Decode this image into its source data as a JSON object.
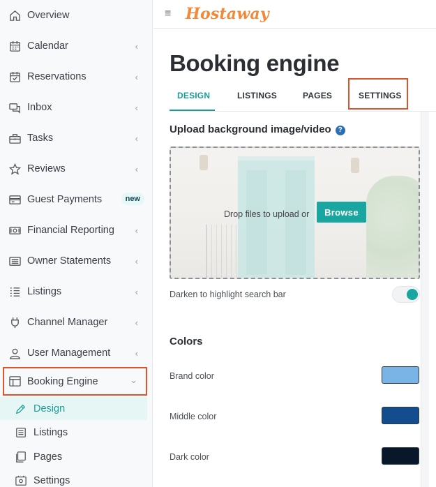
{
  "sidebar": {
    "items": [
      {
        "label": "Overview",
        "icon": "home-icon"
      },
      {
        "label": "Calendar",
        "icon": "calendar-icon",
        "chevron": "‹"
      },
      {
        "label": "Reservations",
        "icon": "calendar-check-icon",
        "chevron": "‹"
      },
      {
        "label": "Inbox",
        "icon": "chat-icon",
        "chevron": "‹"
      },
      {
        "label": "Tasks",
        "icon": "toolbox-icon",
        "chevron": "‹"
      },
      {
        "label": "Reviews",
        "icon": "star-icon",
        "chevron": "‹"
      },
      {
        "label": "Guest Payments",
        "icon": "credit-card-icon",
        "badge": "new"
      },
      {
        "label": "Financial Reporting",
        "icon": "money-icon",
        "chevron": "‹"
      },
      {
        "label": "Owner Statements",
        "icon": "statement-icon",
        "chevron": "‹"
      },
      {
        "label": "Listings",
        "icon": "list-icon",
        "chevron": "‹"
      },
      {
        "label": "Channel Manager",
        "icon": "plug-icon",
        "chevron": "‹"
      },
      {
        "label": "User Management",
        "icon": "user-icon",
        "chevron": "‹"
      },
      {
        "label": "Booking Engine",
        "icon": "layout-icon",
        "chevron": "⌄"
      }
    ],
    "subitems": [
      {
        "label": "Design",
        "icon": "pen-icon"
      },
      {
        "label": "Listings",
        "icon": "list-box-icon"
      },
      {
        "label": "Pages",
        "icon": "pages-icon"
      },
      {
        "label": "Settings",
        "icon": "settings-box-icon"
      }
    ]
  },
  "topbar": {
    "menu_glyph": "≡",
    "logo": "Hostaway"
  },
  "main": {
    "title": "Booking engine",
    "tabs": [
      "DESIGN",
      "LISTINGS",
      "PAGES",
      "SETTINGS"
    ],
    "upload": {
      "heading": "Upload background image/video",
      "help_glyph": "?",
      "drop_text": "Drop files to upload or",
      "browse_label": "Browse"
    },
    "darken_label": "Darken to highlight search bar",
    "darken_on": true,
    "colors_heading": "Colors",
    "colors": [
      {
        "label": "Brand color",
        "hex": "#7ab3e6"
      },
      {
        "label": "Middle color",
        "hex": "#134d8e"
      },
      {
        "label": "Dark color",
        "hex": "#08172a"
      }
    ]
  },
  "accent": "#1aa6a0",
  "highlight_border": "#e0532b"
}
